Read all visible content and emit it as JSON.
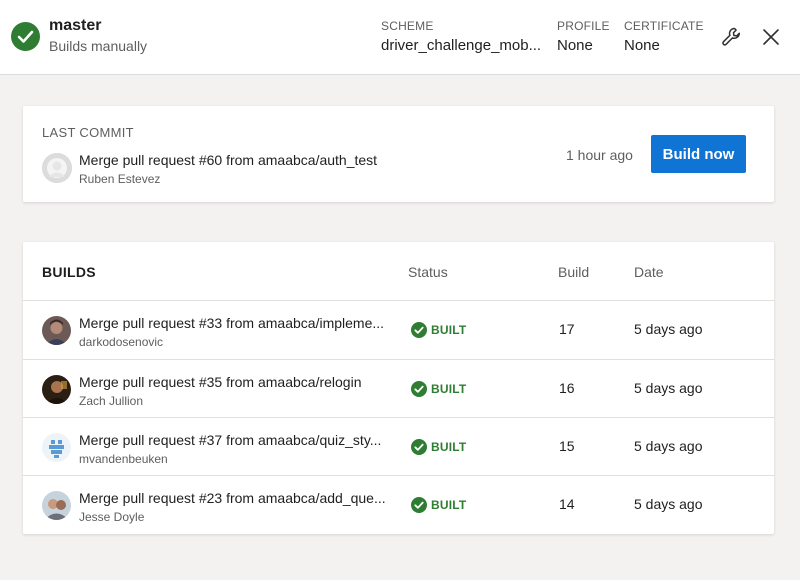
{
  "header": {
    "branch_name": "master",
    "branch_sub": "Builds manually",
    "scheme_label": "SCHEME",
    "scheme_value": "driver_challenge_mob...",
    "profile_label": "PROFILE",
    "profile_value": "None",
    "certificate_label": "CERTIFICATE",
    "certificate_value": "None",
    "icons": [
      "check-icon",
      "wrench-icon",
      "close-icon"
    ]
  },
  "last_commit": {
    "title": "LAST COMMIT",
    "message": "Merge pull request #60 from amaabca/auth_test",
    "author": "Ruben Estevez",
    "time": "1 hour ago",
    "build_now_label": "Build now"
  },
  "builds": {
    "headers": {
      "builds": "BUILDS",
      "status": "Status",
      "build": "Build",
      "date": "Date"
    },
    "rows": [
      {
        "message": "Merge pull request #33 from amaabca/impleme...",
        "author": "darkodosenovic",
        "status": "BUILT",
        "build": "17",
        "date": "5 days ago"
      },
      {
        "message": "Merge pull request #35 from amaabca/relogin",
        "author": "Zach Jullion",
        "status": "BUILT",
        "build": "16",
        "date": "5 days ago"
      },
      {
        "message": "Merge pull request #37 from amaabca/quiz_sty...",
        "author": "mvandenbeuken",
        "status": "BUILT",
        "build": "15",
        "date": "5 days ago"
      },
      {
        "message": "Merge pull request #23 from amaabca/add_que...",
        "author": "Jesse Doyle",
        "status": "BUILT",
        "build": "14",
        "date": "5 days ago"
      }
    ]
  },
  "colors": {
    "accent": "#0f74d3",
    "success": "#2e7d32",
    "background": "#f3f2f1"
  }
}
